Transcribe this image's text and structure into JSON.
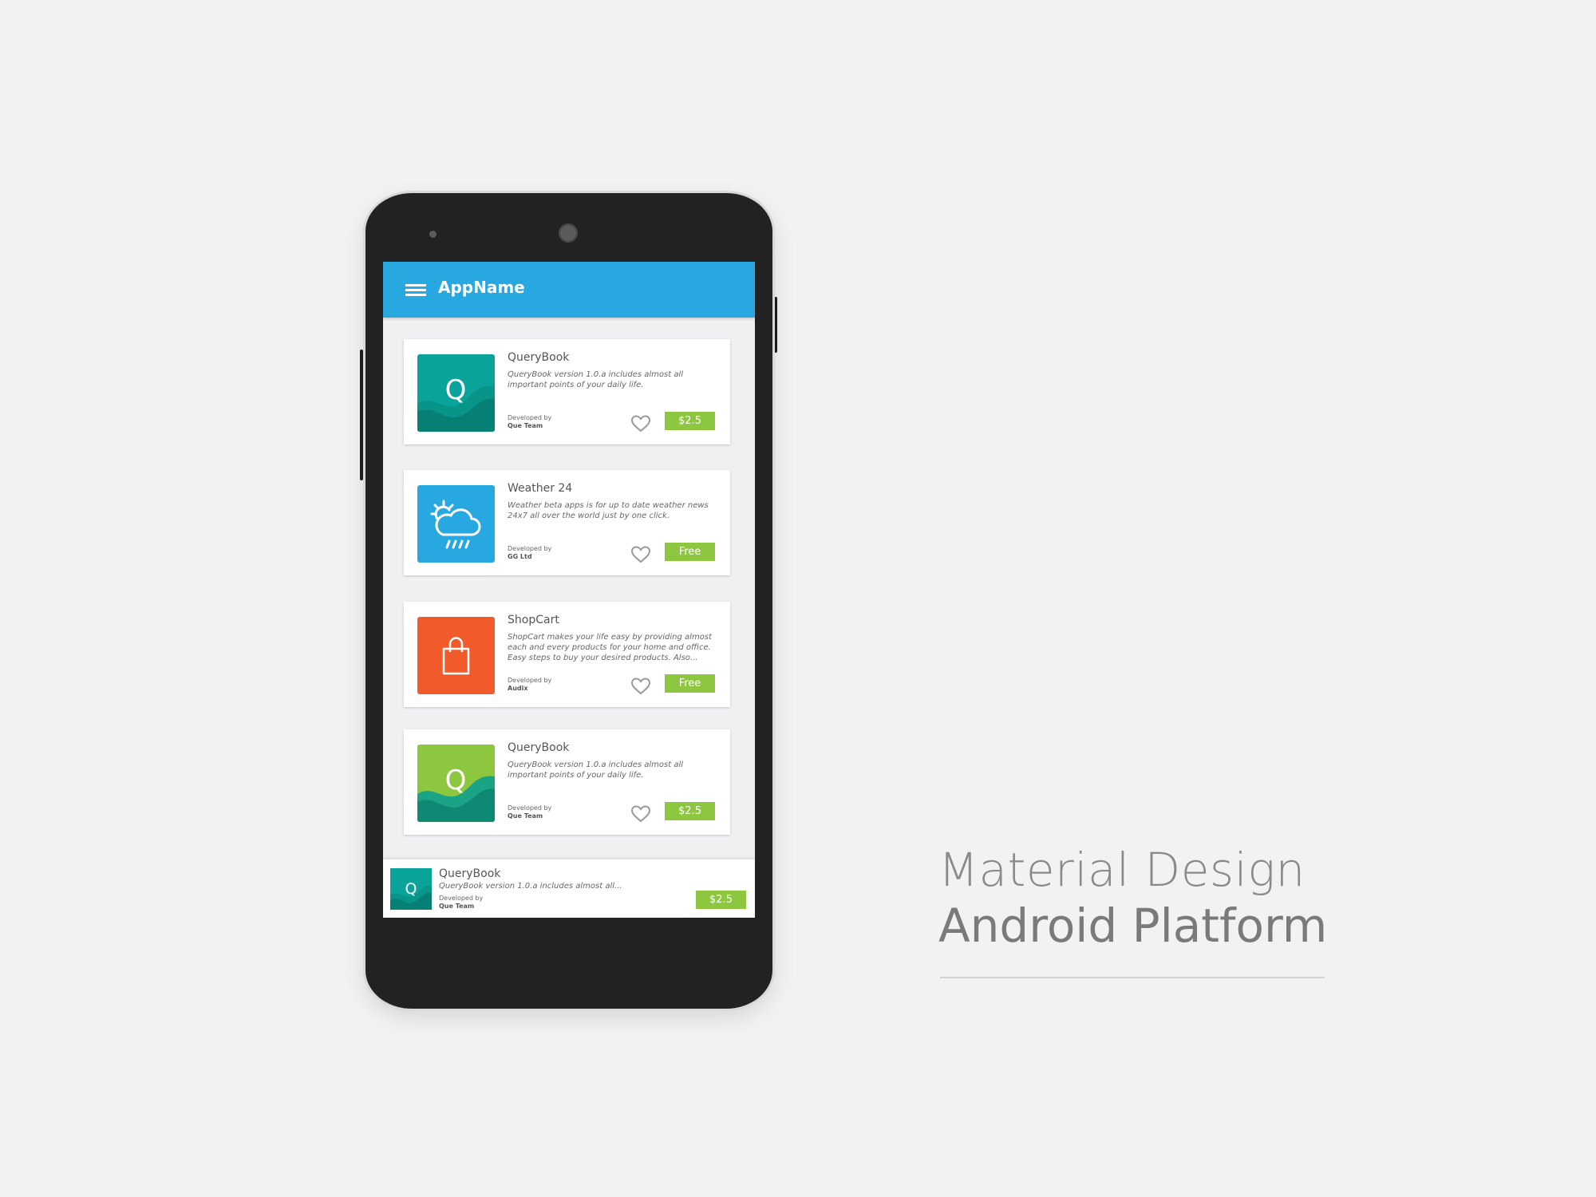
{
  "app": {
    "title": "AppName",
    "menu_icon": "hamburger-menu-icon",
    "appbar_color": "#27a8e0"
  },
  "accent": {
    "price_badge_color": "#8dc63f"
  },
  "cards": [
    {
      "title": "QueryBook",
      "description": "QueryBook version 1.0.a includes almost all important points of your daily life.",
      "developed_by_label": "Developed by",
      "developer": "Que Team",
      "price": "$2.5",
      "icon": "q-letter-icon",
      "icon_color": "#0aa39a"
    },
    {
      "title": "Weather 24",
      "description": "Weather beta apps is for up to date weather news 24x7 all over the world just by one click.",
      "developed_by_label": "Developed by",
      "developer": "GG Ltd",
      "price": "Free",
      "icon": "weather-cloud-rain-icon",
      "icon_color": "#27a8e0"
    },
    {
      "title": "ShopCart",
      "description": "ShopCart makes your life easy by providing almost each and every products for your home and office. Easy steps to buy your desired products. Also...",
      "developed_by_label": "Developed by",
      "developer": "Audix",
      "price": "Free",
      "icon": "shopping-bag-icon",
      "icon_color": "#f15a2b"
    },
    {
      "title": "QueryBook",
      "description": "QueryBook version 1.0.a includes almost all important points of your daily life.",
      "developed_by_label": "Developed by",
      "developer": "Que Team",
      "price": "$2.5",
      "icon": "q-letter-icon",
      "icon_color": "#8dc63f"
    }
  ],
  "bottom_bar": {
    "title": "QueryBook",
    "description": "QueryBook version 1.0.a includes almost all...",
    "developed_by_label": "Developed by",
    "developer": "Que Team",
    "price": "$2.5",
    "icon": "q-letter-icon"
  },
  "headline": {
    "line1": "Material Design",
    "line2": "Android Platform"
  }
}
